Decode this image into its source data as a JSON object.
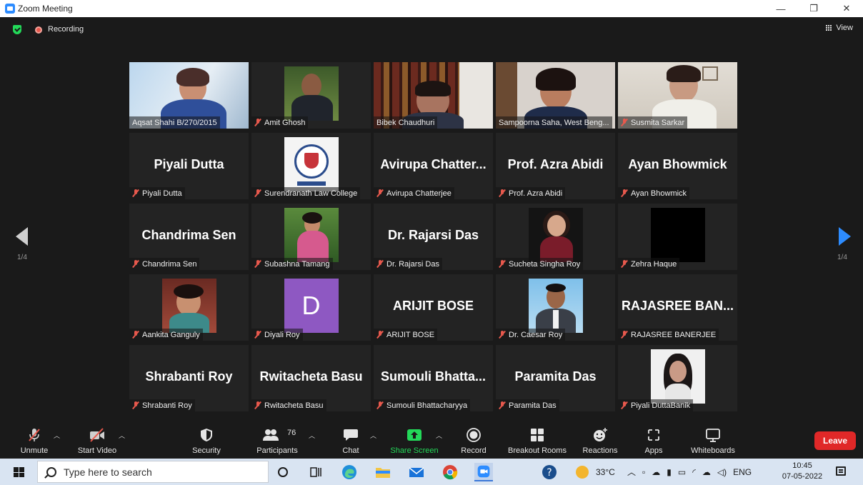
{
  "window": {
    "title": "Zoom Meeting",
    "controls": [
      "—",
      "❐",
      "✕"
    ]
  },
  "topbar": {
    "recording_label": "Recording",
    "view_label": "View"
  },
  "pagination": {
    "left_page": "1/4",
    "right_page": "1/4"
  },
  "participants": [
    {
      "label": "Aqsat Shahi B/270/2015",
      "muted": false,
      "tile": "video",
      "photo": "woman-blue"
    },
    {
      "label": "Amit Ghosh",
      "muted": true,
      "tile": "photo",
      "photo": "man-suit"
    },
    {
      "label": "Bibek Chaudhuri",
      "muted": false,
      "tile": "video",
      "photo": "bookshelf"
    },
    {
      "label": "Sampoorna Saha, West Beng...",
      "muted": false,
      "tile": "video",
      "photo": "woman-smile",
      "active": true
    },
    {
      "label": "Susmita Sarkar",
      "muted": true,
      "tile": "video",
      "photo": "woman-glasses"
    },
    {
      "label": "Piyali Dutta",
      "muted": true,
      "tile": "name",
      "display_name": "Piyali Dutta"
    },
    {
      "label": "Surendranath Law College",
      "muted": true,
      "tile": "photo",
      "photo": "college-logo"
    },
    {
      "label": "Avirupa Chatterjee",
      "muted": true,
      "tile": "name",
      "display_name": "Avirupa  Chatter..."
    },
    {
      "label": "Prof. Azra Abidi",
      "muted": true,
      "tile": "name",
      "display_name": "Prof. Azra Abidi"
    },
    {
      "label": "Ayan Bhowmick",
      "muted": true,
      "tile": "name",
      "display_name": "Ayan Bhowmick"
    },
    {
      "label": "Chandrima Sen",
      "muted": true,
      "tile": "name",
      "display_name": "Chandrima Sen"
    },
    {
      "label": "Subashna Tamang",
      "muted": true,
      "tile": "photo",
      "photo": "woman-garden"
    },
    {
      "label": "Dr. Rajarsi Das",
      "muted": true,
      "tile": "name",
      "display_name": "Dr. Rajarsi Das"
    },
    {
      "label": "Sucheta Singha Roy",
      "muted": true,
      "tile": "photo",
      "photo": "woman-dark"
    },
    {
      "label": "Zehra Haque",
      "muted": true,
      "tile": "photo",
      "photo": "black"
    },
    {
      "label": "Aankita Ganguly",
      "muted": true,
      "tile": "photo",
      "photo": "woman-selfie"
    },
    {
      "label": "Diyali Roy",
      "muted": true,
      "tile": "avatar",
      "avatar_letter": "D"
    },
    {
      "label": "ARIJIT BOSE",
      "muted": true,
      "tile": "name",
      "display_name": "ARIJIT BOSE"
    },
    {
      "label": "Dr. Caesar Roy",
      "muted": true,
      "tile": "photo",
      "photo": "man-formal"
    },
    {
      "label": "RAJASREE BANERJEE",
      "muted": true,
      "tile": "name",
      "display_name": "RAJASREE  BAN..."
    },
    {
      "label": "Shrabanti Roy",
      "muted": true,
      "tile": "name",
      "display_name": "Shrabanti Roy"
    },
    {
      "label": "Rwitacheta Basu",
      "muted": true,
      "tile": "name",
      "display_name": "Rwitacheta Basu"
    },
    {
      "label": "Sumouli Bhattacharyya",
      "muted": true,
      "tile": "name",
      "display_name": "Sumouli  Bhatta..."
    },
    {
      "label": "Paramita Das",
      "muted": true,
      "tile": "name",
      "display_name": "Paramita Das"
    },
    {
      "label": "Piyali DuttaBanik",
      "muted": true,
      "tile": "photo",
      "photo": "woman-bw"
    }
  ],
  "toolbar": {
    "unmute": "Unmute",
    "start_video": "Start Video",
    "security": "Security",
    "participants": "Participants",
    "participant_count": "76",
    "chat": "Chat",
    "share_screen": "Share Screen",
    "record": "Record",
    "breakout_rooms": "Breakout Rooms",
    "reactions": "Reactions",
    "apps": "Apps",
    "whiteboards": "Whiteboards",
    "leave": "Leave"
  },
  "taskbar": {
    "search_placeholder": "Type here to search",
    "temperature": "33°C",
    "language": "ENG",
    "time": "10:45",
    "date": "07-05-2022"
  },
  "colors": {
    "background": "#1a1a1a",
    "tile": "#232323",
    "active_speaker": "#d6e96b",
    "share_green": "#23d959",
    "leave_red": "#e02828",
    "accent_blue": "#2d8cff"
  }
}
